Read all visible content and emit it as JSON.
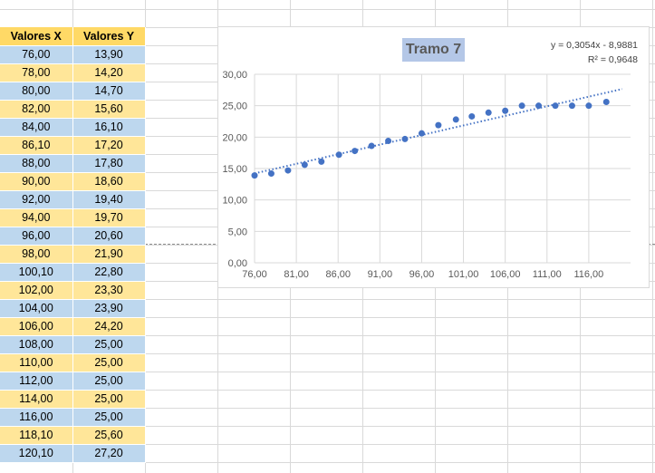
{
  "table": {
    "headers": [
      "Valores X",
      "Valores Y"
    ],
    "rows": [
      [
        "76,00",
        "13,90"
      ],
      [
        "78,00",
        "14,20"
      ],
      [
        "80,00",
        "14,70"
      ],
      [
        "82,00",
        "15,60"
      ],
      [
        "84,00",
        "16,10"
      ],
      [
        "86,10",
        "17,20"
      ],
      [
        "88,00",
        "17,80"
      ],
      [
        "90,00",
        "18,60"
      ],
      [
        "92,00",
        "19,40"
      ],
      [
        "94,00",
        "19,70"
      ],
      [
        "96,00",
        "20,60"
      ],
      [
        "98,00",
        "21,90"
      ],
      [
        "100,10",
        "22,80"
      ],
      [
        "102,00",
        "23,30"
      ],
      [
        "104,00",
        "23,90"
      ],
      [
        "106,00",
        "24,20"
      ],
      [
        "108,00",
        "25,00"
      ],
      [
        "110,00",
        "25,00"
      ],
      [
        "112,00",
        "25,00"
      ],
      [
        "114,00",
        "25,00"
      ],
      [
        "116,00",
        "25,00"
      ],
      [
        "118,10",
        "25,60"
      ],
      [
        "120,10",
        "27,20"
      ]
    ]
  },
  "chart_data": {
    "type": "scatter",
    "title": "Tramo 7",
    "equation": "y = 0,3054x - 8,9881",
    "r_squared": "R² = 0,9648",
    "x": [
      76,
      78,
      80,
      82,
      84,
      86.1,
      88,
      90,
      92,
      94,
      96,
      98,
      100.1,
      102,
      104,
      106,
      108,
      110,
      112,
      114,
      116,
      118.1
    ],
    "y": [
      13.9,
      14.2,
      14.7,
      15.6,
      16.1,
      17.2,
      17.8,
      18.6,
      19.4,
      19.7,
      20.6,
      21.9,
      22.8,
      23.3,
      23.9,
      24.2,
      25.0,
      25.0,
      25.0,
      25.0,
      25.0,
      25.6
    ],
    "trendline": {
      "slope": 0.3054,
      "intercept": -8.9881,
      "style": "dotted"
    },
    "x_ticks": [
      "76,00",
      "81,00",
      "86,00",
      "91,00",
      "96,00",
      "101,00",
      "106,00",
      "111,00",
      "116,00"
    ],
    "y_ticks": [
      "0,00",
      "5,00",
      "10,00",
      "15,00",
      "20,00",
      "25,00",
      "30,00"
    ],
    "xlim": [
      76,
      121
    ],
    "ylim": [
      0,
      30
    ],
    "grid": true,
    "marker_color": "#4472c4"
  }
}
